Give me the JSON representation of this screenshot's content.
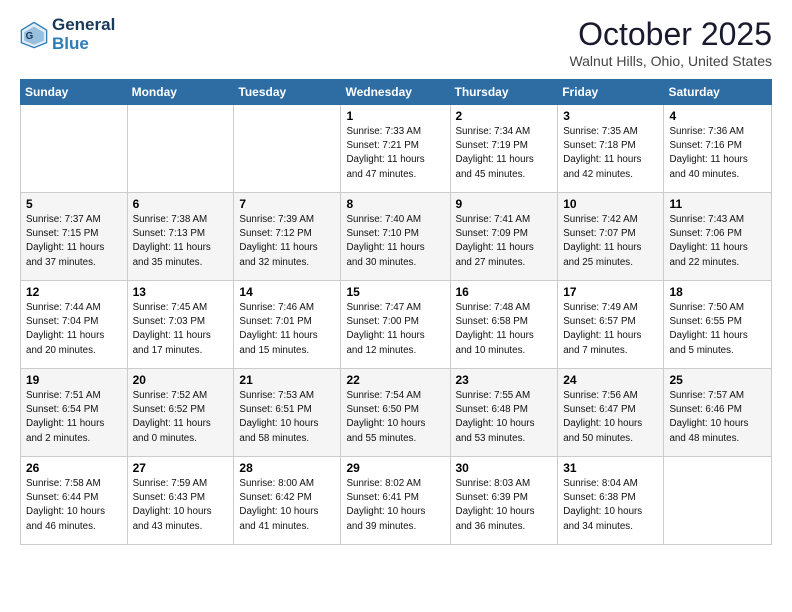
{
  "header": {
    "logo_line1": "General",
    "logo_line2": "Blue",
    "month": "October 2025",
    "location": "Walnut Hills, Ohio, United States"
  },
  "days_of_week": [
    "Sunday",
    "Monday",
    "Tuesday",
    "Wednesday",
    "Thursday",
    "Friday",
    "Saturday"
  ],
  "weeks": [
    [
      {
        "day": "",
        "info": ""
      },
      {
        "day": "",
        "info": ""
      },
      {
        "day": "",
        "info": ""
      },
      {
        "day": "1",
        "info": "Sunrise: 7:33 AM\nSunset: 7:21 PM\nDaylight: 11 hours\nand 47 minutes."
      },
      {
        "day": "2",
        "info": "Sunrise: 7:34 AM\nSunset: 7:19 PM\nDaylight: 11 hours\nand 45 minutes."
      },
      {
        "day": "3",
        "info": "Sunrise: 7:35 AM\nSunset: 7:18 PM\nDaylight: 11 hours\nand 42 minutes."
      },
      {
        "day": "4",
        "info": "Sunrise: 7:36 AM\nSunset: 7:16 PM\nDaylight: 11 hours\nand 40 minutes."
      }
    ],
    [
      {
        "day": "5",
        "info": "Sunrise: 7:37 AM\nSunset: 7:15 PM\nDaylight: 11 hours\nand 37 minutes."
      },
      {
        "day": "6",
        "info": "Sunrise: 7:38 AM\nSunset: 7:13 PM\nDaylight: 11 hours\nand 35 minutes."
      },
      {
        "day": "7",
        "info": "Sunrise: 7:39 AM\nSunset: 7:12 PM\nDaylight: 11 hours\nand 32 minutes."
      },
      {
        "day": "8",
        "info": "Sunrise: 7:40 AM\nSunset: 7:10 PM\nDaylight: 11 hours\nand 30 minutes."
      },
      {
        "day": "9",
        "info": "Sunrise: 7:41 AM\nSunset: 7:09 PM\nDaylight: 11 hours\nand 27 minutes."
      },
      {
        "day": "10",
        "info": "Sunrise: 7:42 AM\nSunset: 7:07 PM\nDaylight: 11 hours\nand 25 minutes."
      },
      {
        "day": "11",
        "info": "Sunrise: 7:43 AM\nSunset: 7:06 PM\nDaylight: 11 hours\nand 22 minutes."
      }
    ],
    [
      {
        "day": "12",
        "info": "Sunrise: 7:44 AM\nSunset: 7:04 PM\nDaylight: 11 hours\nand 20 minutes."
      },
      {
        "day": "13",
        "info": "Sunrise: 7:45 AM\nSunset: 7:03 PM\nDaylight: 11 hours\nand 17 minutes."
      },
      {
        "day": "14",
        "info": "Sunrise: 7:46 AM\nSunset: 7:01 PM\nDaylight: 11 hours\nand 15 minutes."
      },
      {
        "day": "15",
        "info": "Sunrise: 7:47 AM\nSunset: 7:00 PM\nDaylight: 11 hours\nand 12 minutes."
      },
      {
        "day": "16",
        "info": "Sunrise: 7:48 AM\nSunset: 6:58 PM\nDaylight: 11 hours\nand 10 minutes."
      },
      {
        "day": "17",
        "info": "Sunrise: 7:49 AM\nSunset: 6:57 PM\nDaylight: 11 hours\nand 7 minutes."
      },
      {
        "day": "18",
        "info": "Sunrise: 7:50 AM\nSunset: 6:55 PM\nDaylight: 11 hours\nand 5 minutes."
      }
    ],
    [
      {
        "day": "19",
        "info": "Sunrise: 7:51 AM\nSunset: 6:54 PM\nDaylight: 11 hours\nand 2 minutes."
      },
      {
        "day": "20",
        "info": "Sunrise: 7:52 AM\nSunset: 6:52 PM\nDaylight: 11 hours\nand 0 minutes."
      },
      {
        "day": "21",
        "info": "Sunrise: 7:53 AM\nSunset: 6:51 PM\nDaylight: 10 hours\nand 58 minutes."
      },
      {
        "day": "22",
        "info": "Sunrise: 7:54 AM\nSunset: 6:50 PM\nDaylight: 10 hours\nand 55 minutes."
      },
      {
        "day": "23",
        "info": "Sunrise: 7:55 AM\nSunset: 6:48 PM\nDaylight: 10 hours\nand 53 minutes."
      },
      {
        "day": "24",
        "info": "Sunrise: 7:56 AM\nSunset: 6:47 PM\nDaylight: 10 hours\nand 50 minutes."
      },
      {
        "day": "25",
        "info": "Sunrise: 7:57 AM\nSunset: 6:46 PM\nDaylight: 10 hours\nand 48 minutes."
      }
    ],
    [
      {
        "day": "26",
        "info": "Sunrise: 7:58 AM\nSunset: 6:44 PM\nDaylight: 10 hours\nand 46 minutes."
      },
      {
        "day": "27",
        "info": "Sunrise: 7:59 AM\nSunset: 6:43 PM\nDaylight: 10 hours\nand 43 minutes."
      },
      {
        "day": "28",
        "info": "Sunrise: 8:00 AM\nSunset: 6:42 PM\nDaylight: 10 hours\nand 41 minutes."
      },
      {
        "day": "29",
        "info": "Sunrise: 8:02 AM\nSunset: 6:41 PM\nDaylight: 10 hours\nand 39 minutes."
      },
      {
        "day": "30",
        "info": "Sunrise: 8:03 AM\nSunset: 6:39 PM\nDaylight: 10 hours\nand 36 minutes."
      },
      {
        "day": "31",
        "info": "Sunrise: 8:04 AM\nSunset: 6:38 PM\nDaylight: 10 hours\nand 34 minutes."
      },
      {
        "day": "",
        "info": ""
      }
    ]
  ]
}
